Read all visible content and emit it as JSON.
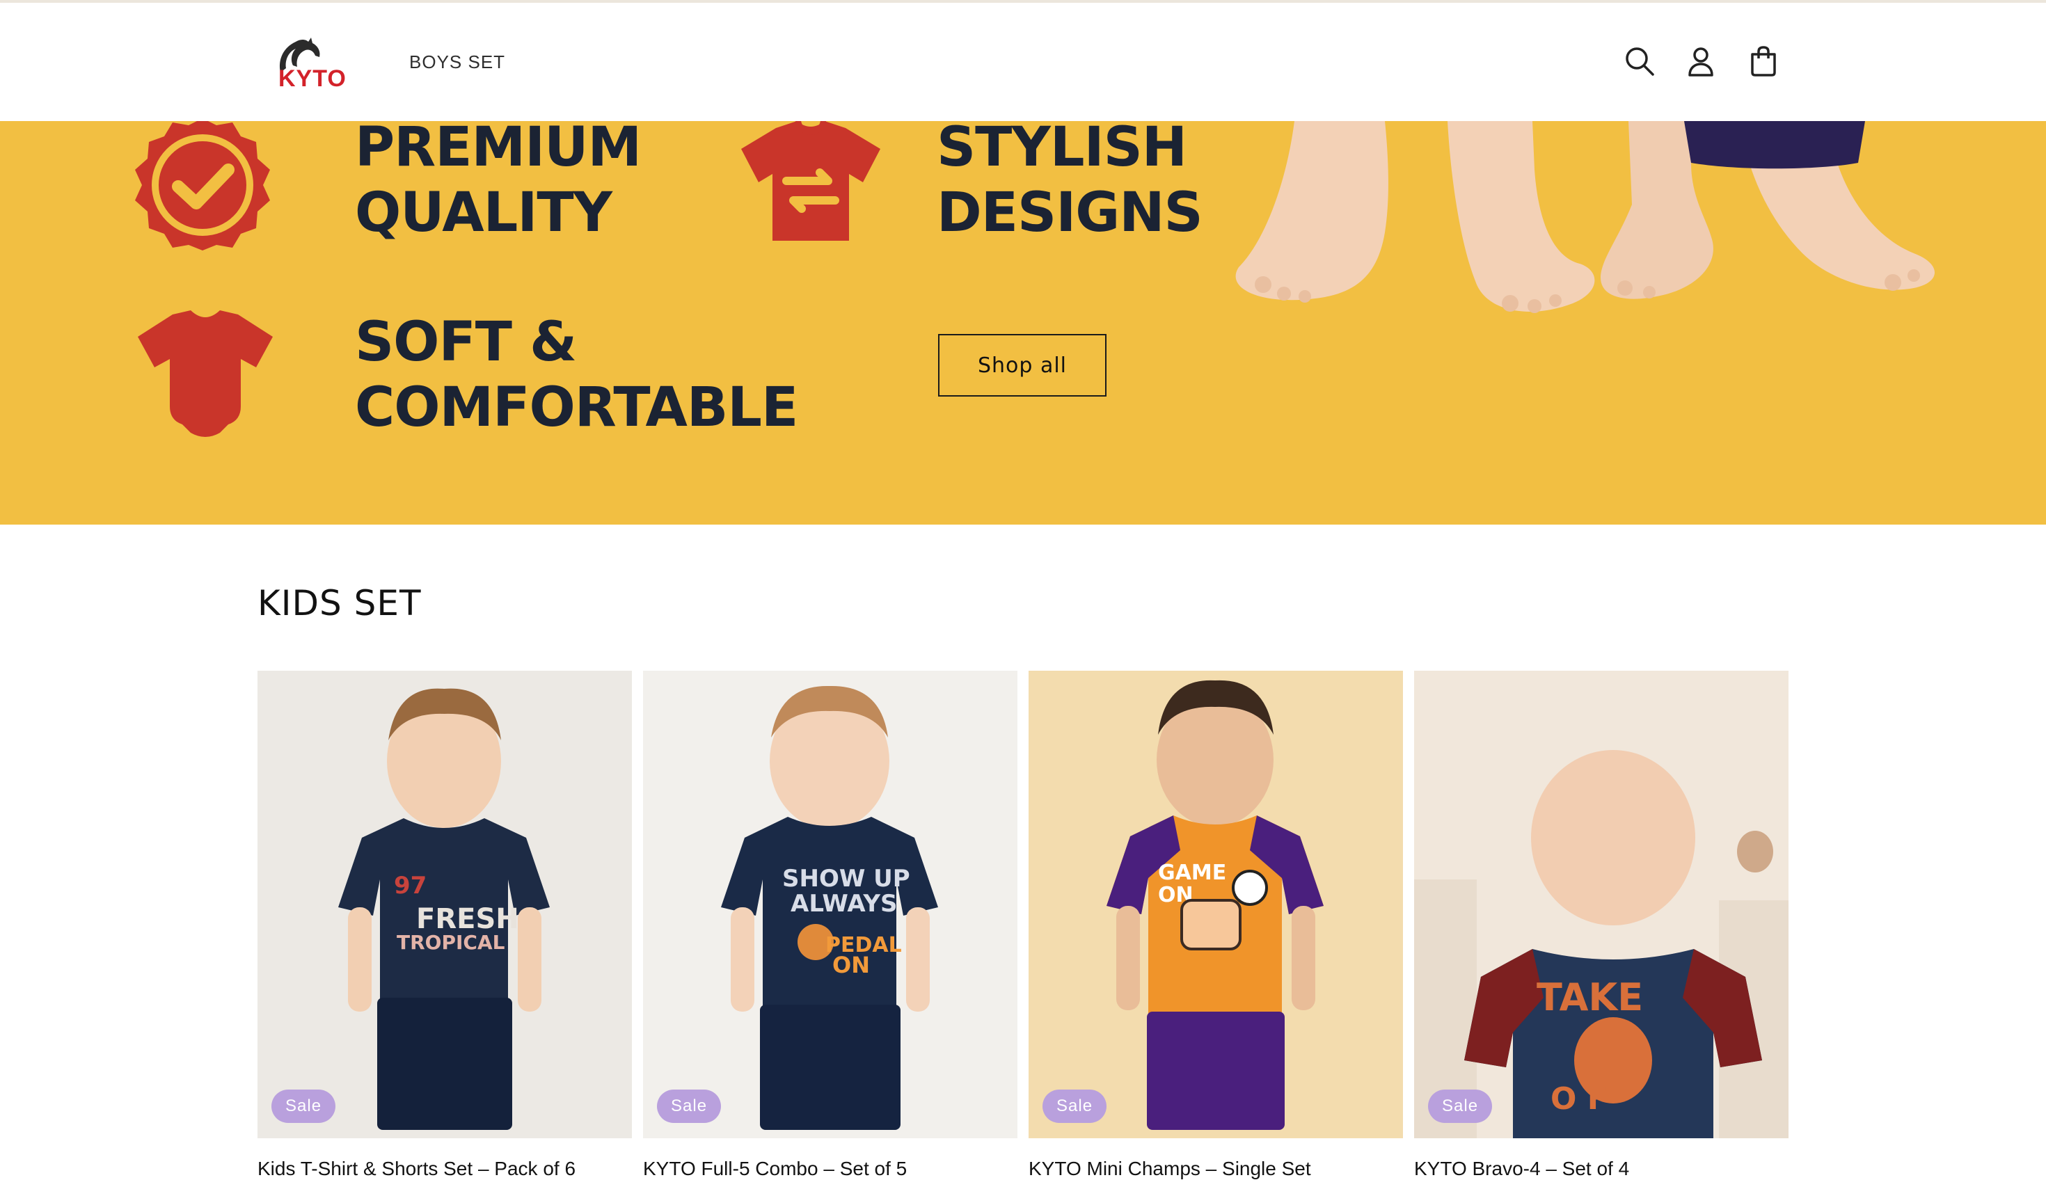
{
  "header": {
    "logo_text": "KYTO",
    "nav": [
      "BOYS SET"
    ],
    "icons": [
      "search-icon",
      "account-icon",
      "cart-icon"
    ]
  },
  "hero": {
    "features": [
      {
        "line1": "PREMIUM",
        "line2": "QUALITY",
        "icon": "check-badge-icon"
      },
      {
        "line1": "STYLISH",
        "line2": "DESIGNS",
        "icon": "tshirt-swap-icon"
      },
      {
        "line1": "SOFT &",
        "line2": "COMFORTABLE",
        "icon": "onesie-icon"
      }
    ],
    "cta_label": "Shop all",
    "background": "#f2bf42",
    "accent": "#c9352a"
  },
  "collection": {
    "title": "KIDS SET",
    "products": [
      {
        "badge": "Sale",
        "title": "Kids T-Shirt & Shorts Set – Pack of 6",
        "bg": "#ece9e4",
        "shirt": "#1d2b45",
        "shorts": "#14213b",
        "print": "97 FRESH TROPICAL"
      },
      {
        "badge": "Sale",
        "title": "KYTO Full-5 Combo – Set of 5",
        "bg": "#f2f0ec",
        "shirt": "#1a2a47",
        "shorts": "#152340",
        "print": "SHOW UP ALWAYS PEDAL ON"
      },
      {
        "badge": "Sale",
        "title": "KYTO Mini Champs – Single Set",
        "bg": "#f3dcae",
        "shirt": "#f0942a",
        "shorts": "#4a1f7d",
        "print": "GAME ON"
      },
      {
        "badge": "Sale",
        "title": "KYTO Bravo-4 – Set of 4",
        "bg": "#f1e7db",
        "shirt": "#243758",
        "shorts": "#7d2020",
        "print": "TAKE OFF"
      }
    ]
  }
}
